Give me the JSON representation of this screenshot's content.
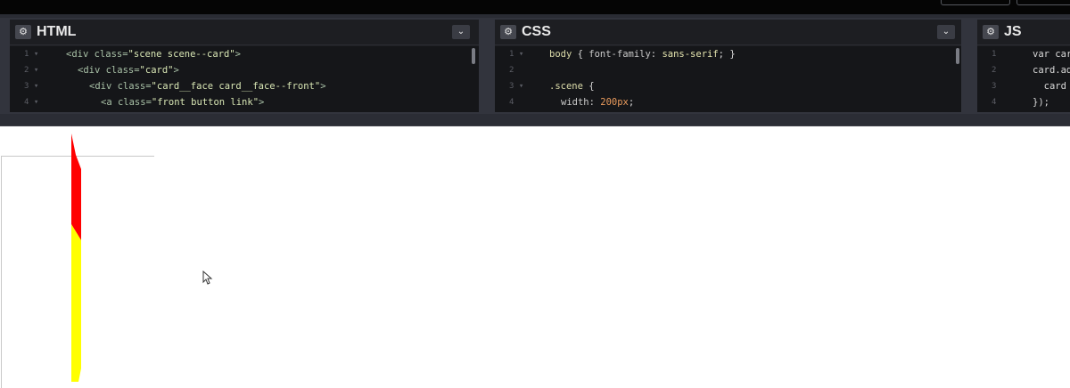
{
  "panels": [
    {
      "title": "HTML",
      "lines": [
        {
          "num": "1",
          "arrow": true
        },
        {
          "num": "2",
          "arrow": true
        },
        {
          "num": "3",
          "arrow": true
        },
        {
          "num": "4",
          "arrow": true
        }
      ],
      "code": [
        {
          "t1": "<div ",
          "a": "class=",
          "s": "\"scene scene--card\"",
          "t2": ">"
        },
        {
          "t1": "<div ",
          "a": "class=",
          "s": "\"card\"",
          "t2": ">"
        },
        {
          "t1": "<div ",
          "a": "class=",
          "s": "\"card__face card__face--front\"",
          "t2": ">"
        },
        {
          "t1": "<a ",
          "a": "class=",
          "s": "\"front button link\"",
          "t2": ">"
        }
      ]
    },
    {
      "title": "CSS",
      "lines": [
        {
          "num": "1",
          "arrow": true
        },
        {
          "num": "2",
          "arrow": false
        },
        {
          "num": "3",
          "arrow": true
        },
        {
          "num": "4",
          "arrow": false
        }
      ],
      "code": [
        {
          "sel": "body ",
          "brace": "{ ",
          "prop": "font-family: ",
          "val": "sans-serif",
          "end": "; }"
        },
        {
          "sel": "",
          "brace": "",
          "prop": "",
          "val": "",
          "end": ""
        },
        {
          "sel": ".scene ",
          "brace": "{",
          "prop": "",
          "val": "",
          "end": ""
        },
        {
          "sel": "",
          "brace": "",
          "prop": "width: ",
          "val": "200px",
          "end": ";"
        }
      ]
    },
    {
      "title": "JS",
      "lines": [
        {
          "num": "1",
          "arrow": false
        },
        {
          "num": "2",
          "arrow": false
        },
        {
          "num": "3",
          "arrow": false
        },
        {
          "num": "4",
          "arrow": false
        }
      ],
      "code": [
        {
          "text": "var car"
        },
        {
          "text": "card.ad"
        },
        {
          "text": "  card"
        },
        {
          "text": "});"
        }
      ]
    }
  ],
  "icons": {
    "gear": "⚙",
    "chevron": "⌄",
    "fold": "▾"
  },
  "colors": {
    "card_red": "#ff0000",
    "card_yellow": "#ffff00",
    "editor_bg": "#151619",
    "header_bg": "#1d1e22"
  }
}
